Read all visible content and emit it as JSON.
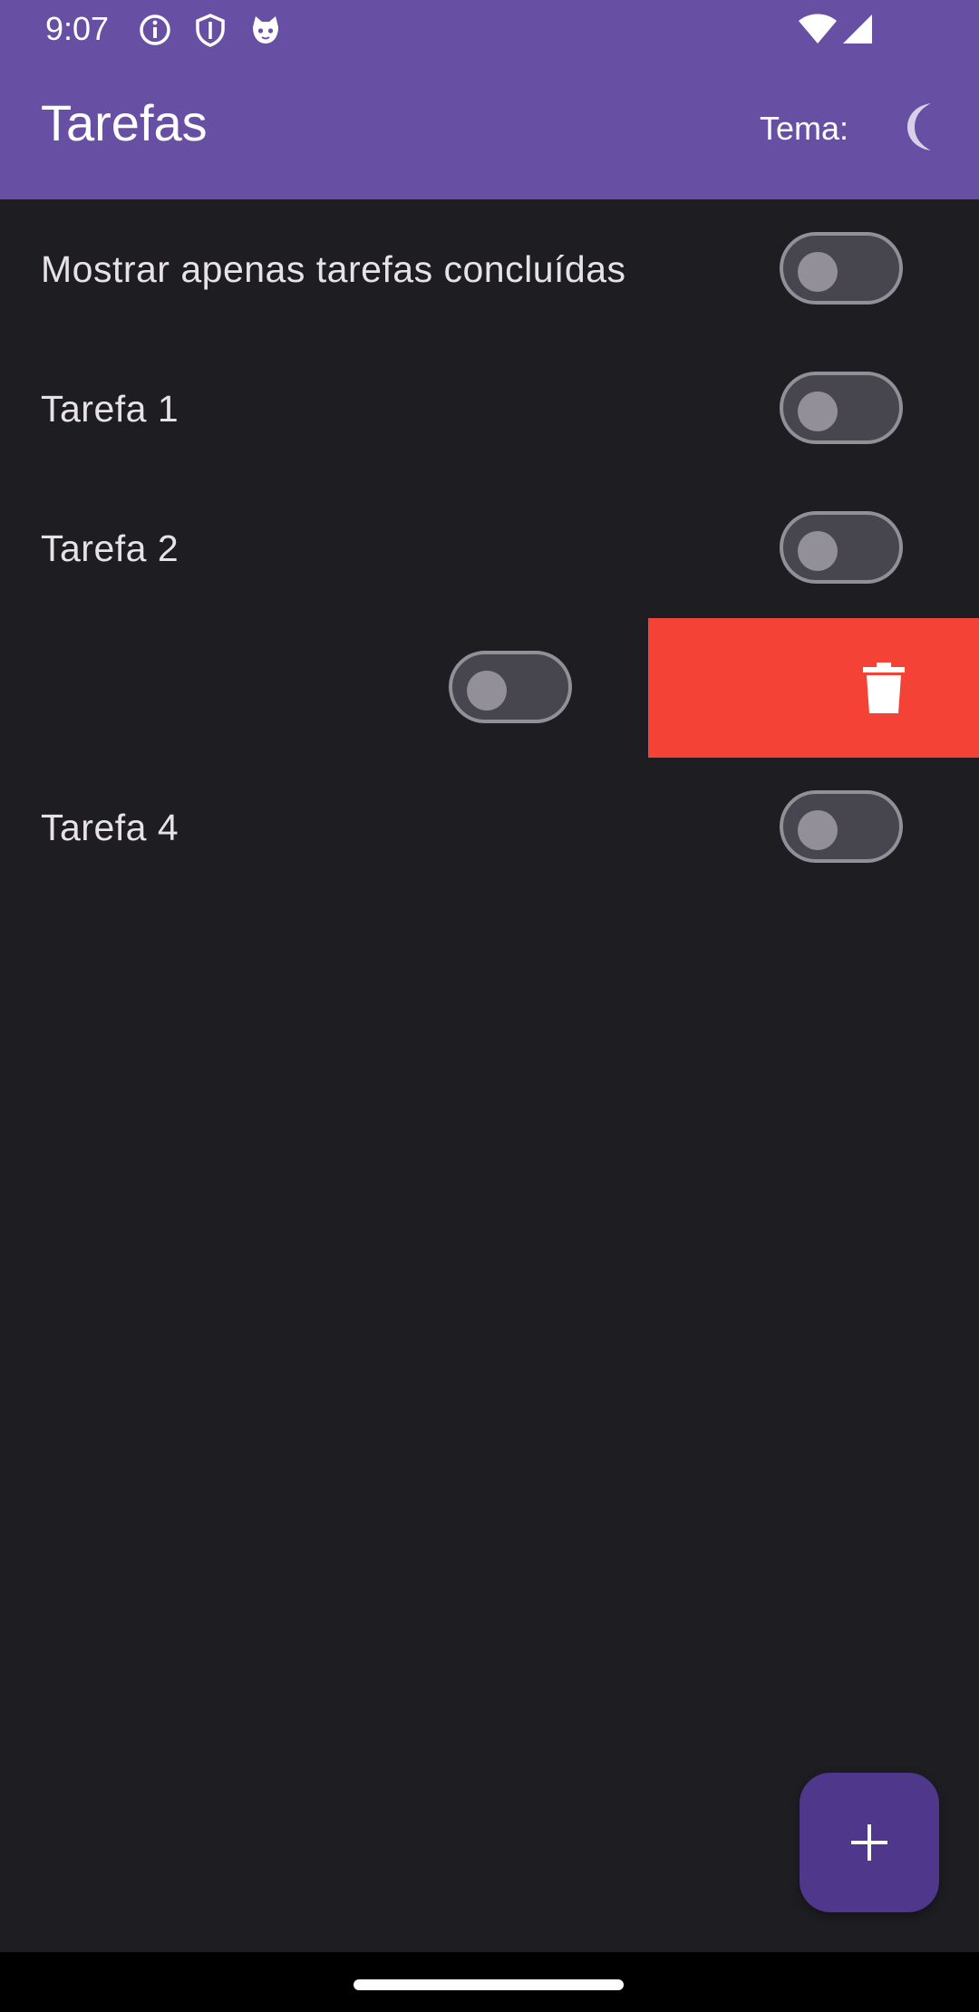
{
  "status_bar": {
    "time": "9:07",
    "icons": [
      "info-icon",
      "shield-icon",
      "cat-icon",
      "wifi-icon",
      "signal-icon"
    ]
  },
  "app_bar": {
    "title": "Tarefas",
    "theme_label": "Tema:",
    "theme_icon": "moon-icon"
  },
  "filter": {
    "label": "Mostrar apenas tarefas concluídas",
    "checked": false
  },
  "tasks": [
    {
      "label": "Tarefa 1",
      "checked": false
    },
    {
      "label": "Tarefa 2",
      "checked": false
    },
    {
      "label": "",
      "checked": false,
      "swiped": true
    },
    {
      "label": "Tarefa 4",
      "checked": false
    }
  ],
  "swipe_action": {
    "icon": "trash-icon",
    "color": "#f44336"
  },
  "fab": {
    "icon": "plus-icon"
  },
  "colors": {
    "primary": "#6750a4",
    "fab": "#4f378b",
    "background": "#1e1d22",
    "switch_track": "#47464f",
    "switch_outline": "#938f99",
    "delete": "#f44336"
  }
}
